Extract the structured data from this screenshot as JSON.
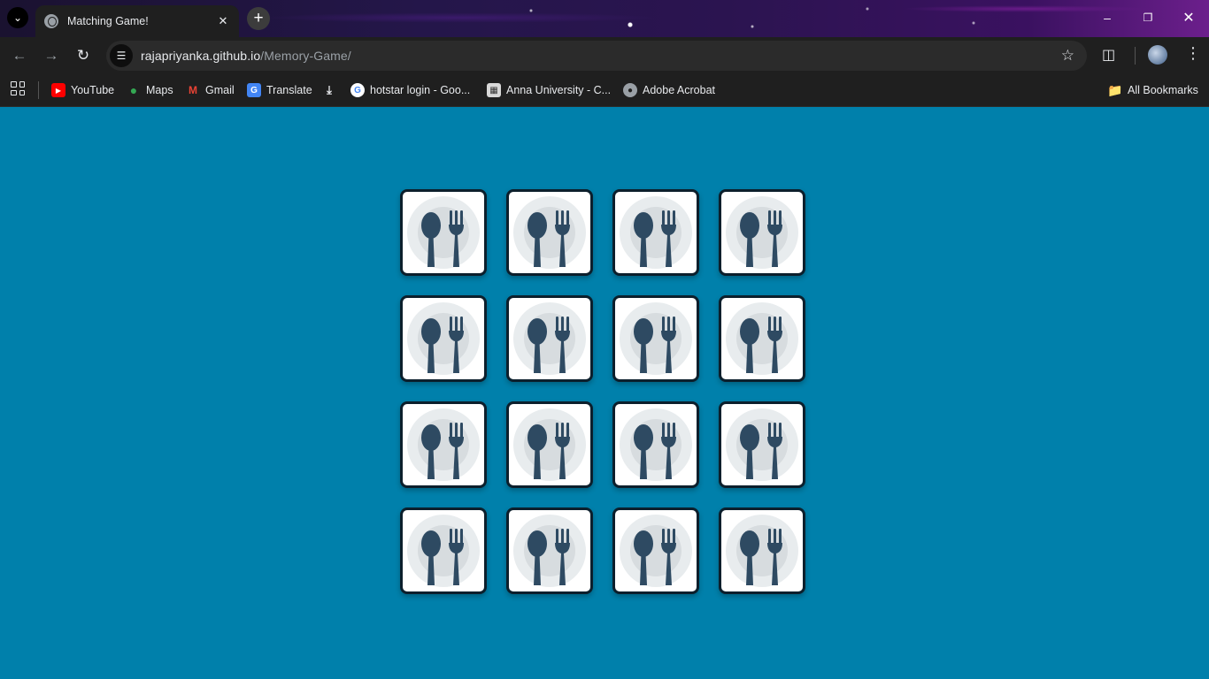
{
  "browser": {
    "tab_title": "Matching Game!",
    "url_host": "rajapriyanka.github.io",
    "url_path": "/Memory-Game/",
    "bookmarks": [
      {
        "label": "YouTube",
        "icon": "youtube-icon"
      },
      {
        "label": "Maps",
        "icon": "maps-icon"
      },
      {
        "label": "Gmail",
        "icon": "gmail-icon"
      },
      {
        "label": "Translate",
        "icon": "translate-icon"
      },
      {
        "label": "",
        "icon": "download-icon"
      },
      {
        "label": "hotstar login - Goo...",
        "icon": "google-icon"
      },
      {
        "label": "Anna University - C...",
        "icon": "university-icon"
      },
      {
        "label": "Adobe Acrobat",
        "icon": "globe-icon"
      }
    ],
    "all_bookmarks": "All Bookmarks"
  },
  "game": {
    "rows": 4,
    "columns": 4,
    "card_count": 16,
    "card_face": "face-down",
    "card_back_icon": "spoon-fork-plate-icon"
  },
  "colors": {
    "page_background": "#0080ab",
    "card_background": "#ffffff",
    "card_border": "#0c1f2c",
    "plate": "#e8ecee",
    "cutlery": "#2e4a62"
  }
}
